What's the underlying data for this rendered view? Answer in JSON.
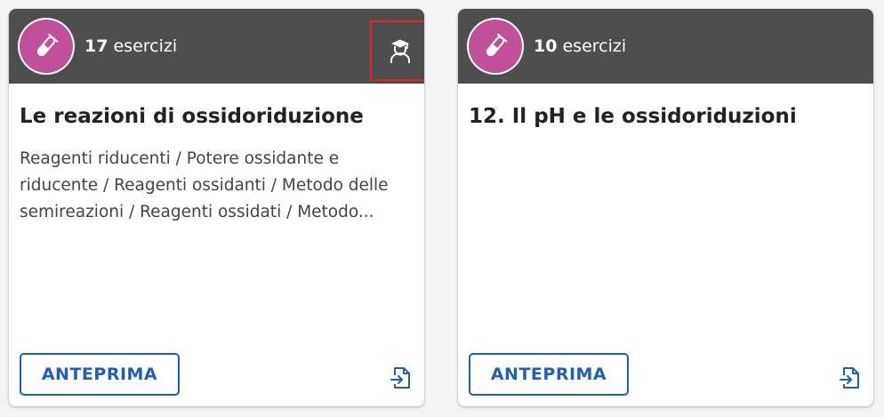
{
  "cards": [
    {
      "subject_icon": "test-tube-icon",
      "count_number": "17",
      "count_label": " esercizi",
      "teacher_icon": "graduation-cap-person-icon",
      "title": "Le reazioni di ossidoriduzione",
      "description": "Reagenti riducenti / Potere ossidante e riducente / Reagenti ossidanti / Metodo delle semireazioni / Reagenti ossidati / Metodo...",
      "preview_label": "ANTEPRIMA",
      "open_icon": "open-in-file-icon"
    },
    {
      "subject_icon": "test-tube-icon",
      "count_number": "10",
      "count_label": " esercizi",
      "title": "12. Il pH e le ossidoriduzioni",
      "description": "",
      "preview_label": "ANTEPRIMA",
      "open_icon": "open-in-file-icon"
    }
  ],
  "colors": {
    "header_bg": "#4e4e4e",
    "subject_accent": "#c0509a",
    "primary_blue": "#1f5fb8",
    "highlight_red": "#e4262b"
  }
}
